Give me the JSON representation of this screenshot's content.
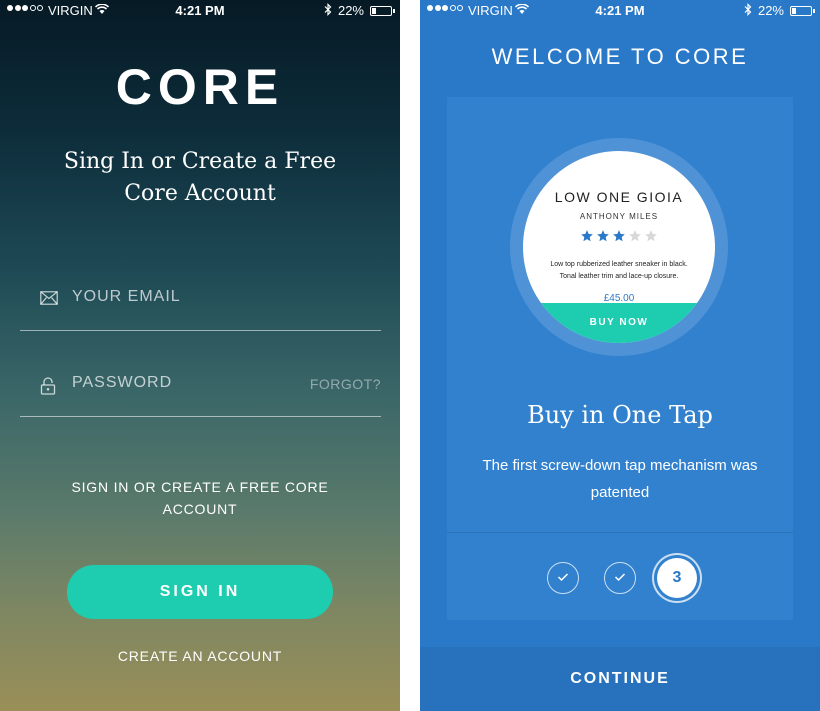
{
  "status_bar": {
    "carrier": "VIRGIN",
    "time": "4:21 PM",
    "battery": "22%",
    "signal_dots_filled": 3,
    "signal_dots_total": 5,
    "battery_level": 0.22
  },
  "signin_screen": {
    "logo": "CORE",
    "subtitle": "Sing In or Create a Free Core Account",
    "email_placeholder": "YOUR EMAIL",
    "password_placeholder": "PASSWORD",
    "forgot_label": "FORGOT?",
    "promo_text": "SIGN IN OR CREATE A FREE CORE ACCOUNT",
    "signin_button": "SIGN IN",
    "create_account_link": "CREATE AN ACCOUNT",
    "icons": {
      "email": "envelope-icon",
      "password": "lock-icon"
    }
  },
  "onboarding_screen": {
    "title": "WELCOME TO CORE",
    "product": {
      "name": "LOW ONE GIOIA",
      "brand": "ANTHONY MILES",
      "rating": 3,
      "rating_max": 5,
      "description": "Low top rubberized leather sneaker in black. Tonal leather trim and lace-up closure.",
      "price": "£45.00",
      "buy_button": "BUY NOW"
    },
    "feature_title": "Buy in One Tap",
    "feature_description": "The first screw-down tap mechanism was patented",
    "steps": {
      "current": "3",
      "icons": [
        "check-icon",
        "check-icon"
      ]
    },
    "continue_button": "CONTINUE"
  },
  "colors": {
    "accent_teal": "#1ecdb0",
    "primary_blue": "#2a79c8",
    "panel_blue": "#3181cf",
    "star_filled": "#2a79c8",
    "star_empty": "#d8d8d8"
  }
}
